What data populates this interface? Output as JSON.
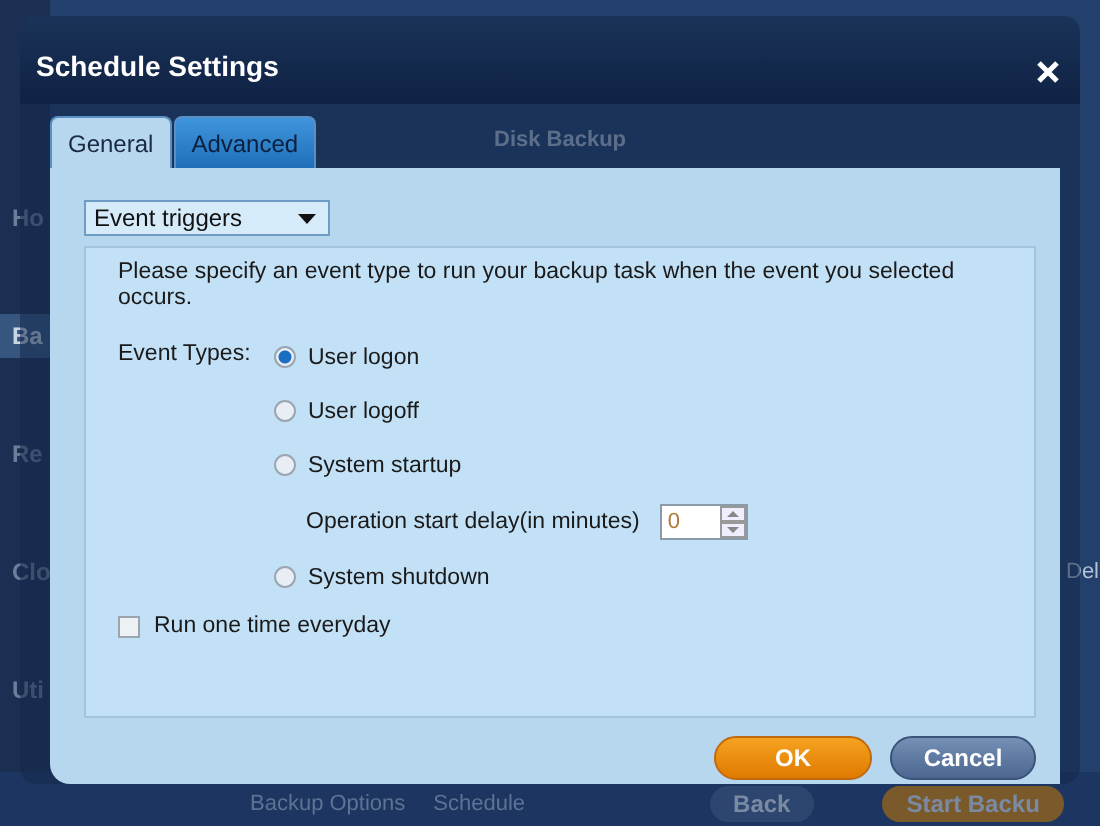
{
  "background": {
    "sidebar": [
      {
        "label": "Ho",
        "selected": false
      },
      {
        "label": "Ba",
        "selected": true
      },
      {
        "label": "Re",
        "selected": false
      },
      {
        "label": "Clo",
        "selected": false
      },
      {
        "label": "Uti",
        "selected": false
      }
    ],
    "heading": "Disk Backup",
    "column_1": "Del",
    "toolbar": [
      "Backup Options",
      "Schedule"
    ],
    "nav": [
      {
        "label": "Back",
        "kind": "secondary"
      },
      {
        "label": "Start Backu",
        "kind": "primary"
      }
    ]
  },
  "window": {
    "title": "Schedule Settings"
  },
  "tabs": [
    {
      "label": "General",
      "selected": true
    },
    {
      "label": "Advanced",
      "selected": false
    }
  ],
  "trigger_select": {
    "value": "Event triggers"
  },
  "description": "Please specify an event type to run your backup task when the event you selected occurs.",
  "event_types": {
    "label": "Event Types:",
    "options": [
      {
        "label": "User logon",
        "selected": true
      },
      {
        "label": "User logoff",
        "selected": false
      },
      {
        "label": "System startup",
        "selected": false,
        "delay": {
          "label": "Operation start delay(in minutes)",
          "value": "0"
        }
      },
      {
        "label": "System shutdown",
        "selected": false
      }
    ]
  },
  "run_daily": {
    "label": "Run one time everyday",
    "checked": false
  },
  "buttons": [
    {
      "label": "OK",
      "kind": "primary"
    },
    {
      "label": "Cancel",
      "kind": "secondary"
    }
  ]
}
